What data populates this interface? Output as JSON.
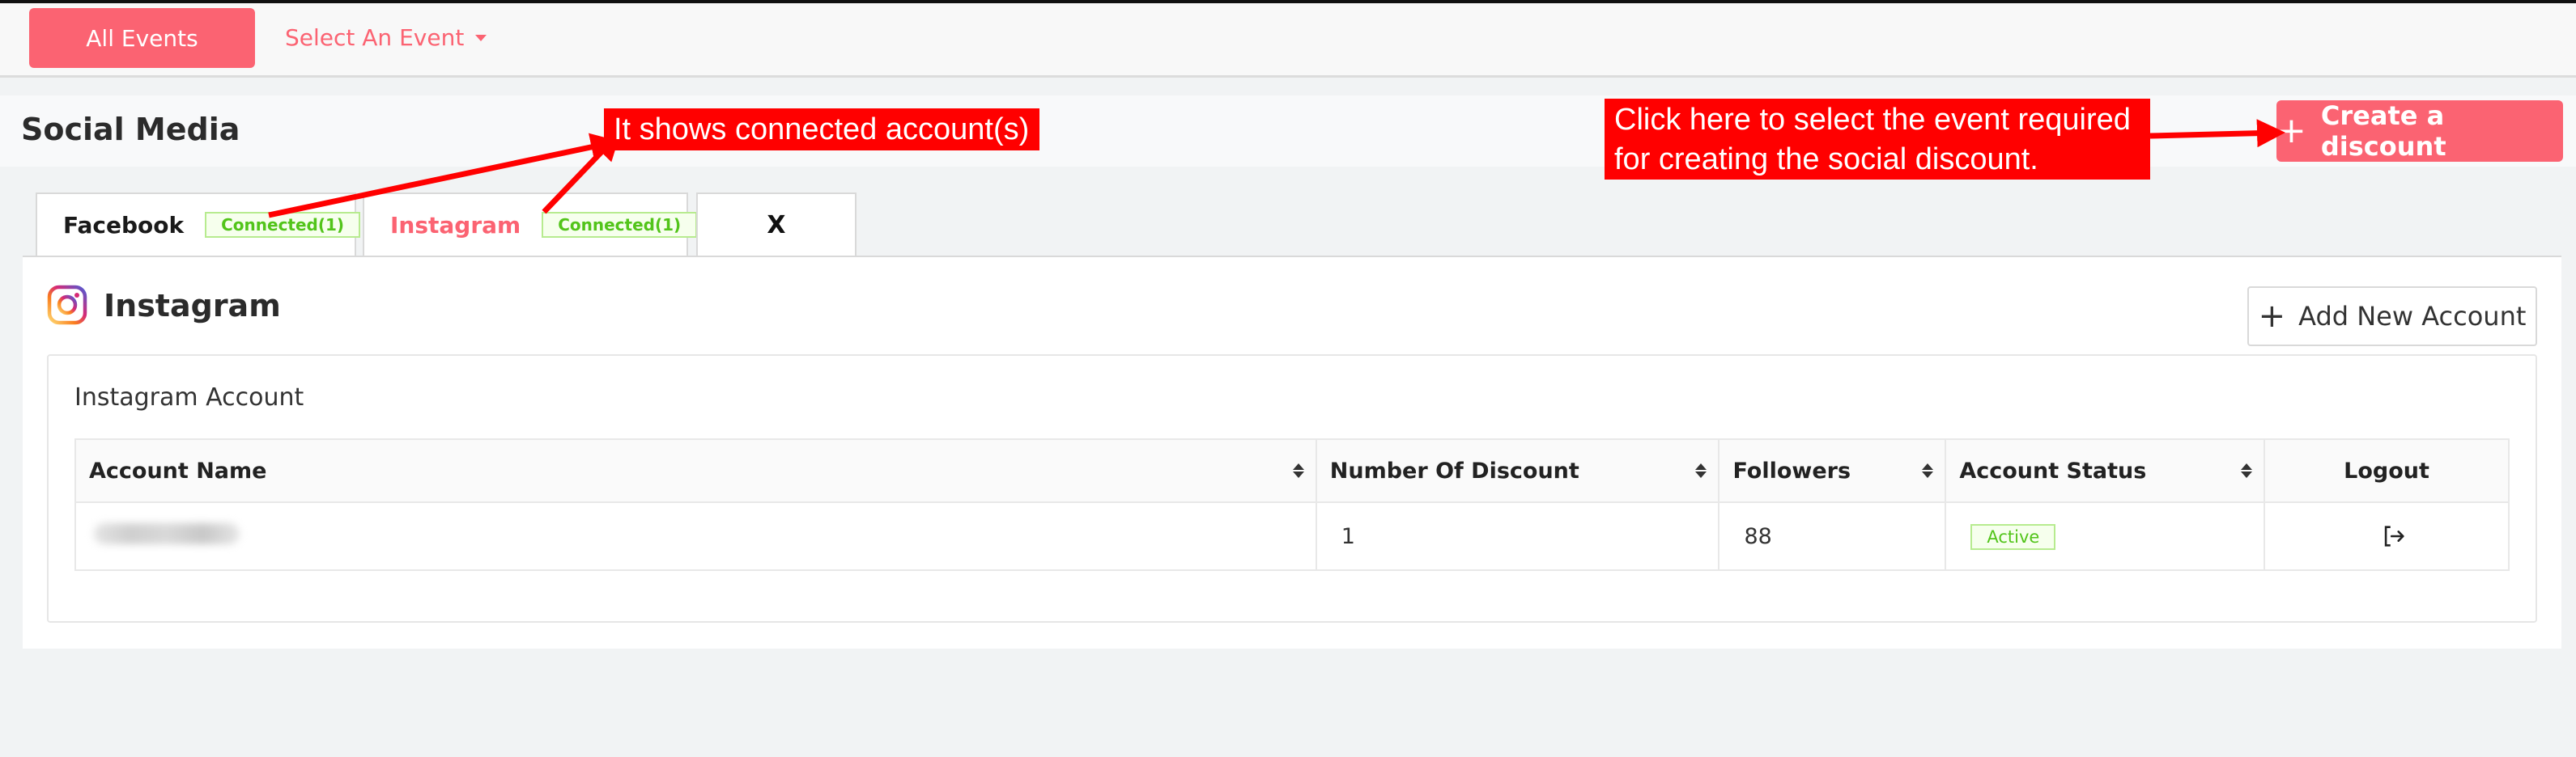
{
  "topbar": {
    "all_events_label": "All Events",
    "select_event_label": "Select An Event"
  },
  "page": {
    "title": "Social Media",
    "create_label": "Create a discount"
  },
  "tabs": [
    {
      "label": "Facebook",
      "badge": "Connected(1)"
    },
    {
      "label": "Instagram",
      "badge": "Connected(1)"
    },
    {
      "label": "X"
    }
  ],
  "panel": {
    "title": "Instagram",
    "add_label": "Add New Account",
    "card_title": "Instagram Account"
  },
  "table": {
    "headers": [
      "Account Name",
      "Number Of Discount",
      "Followers",
      "Account Status",
      "Logout"
    ],
    "rows": [
      {
        "number_of_discount": "1",
        "followers": "88",
        "status": "Active"
      }
    ]
  },
  "annotations": {
    "connected": "It shows connected account(s)",
    "create": "Click here to select the event required for creating the social discount."
  },
  "colors": {
    "accent": "#fb6372",
    "success": "#52c41a",
    "annotation": "#ff0000"
  }
}
